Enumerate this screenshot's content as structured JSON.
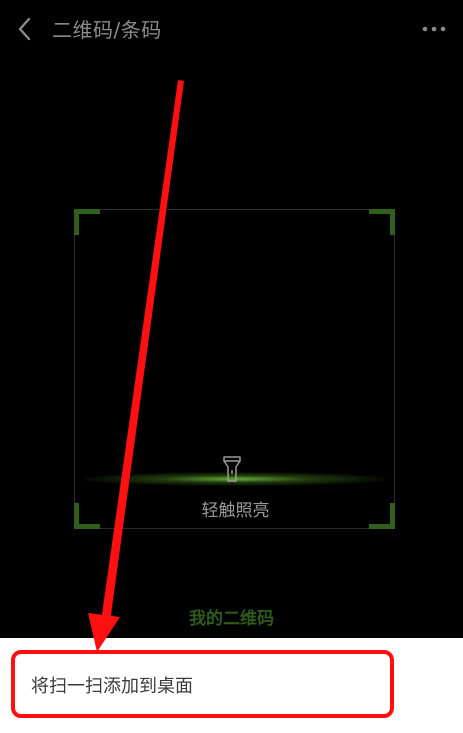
{
  "header": {
    "title": "二维码/条码",
    "back_icon": "chevron-left-icon",
    "more_icon": "more-dots-icon"
  },
  "scanner": {
    "torch_label": "轻触照亮",
    "corner_color": "#2f5f1a"
  },
  "my_qr_label": "我的二维码",
  "bottom_sheet": {
    "item_label": "将扫一扫添加到桌面"
  },
  "colors": {
    "background": "#000000",
    "accent_green": "#2e5a1c",
    "annotation_red": "#ff1010"
  }
}
